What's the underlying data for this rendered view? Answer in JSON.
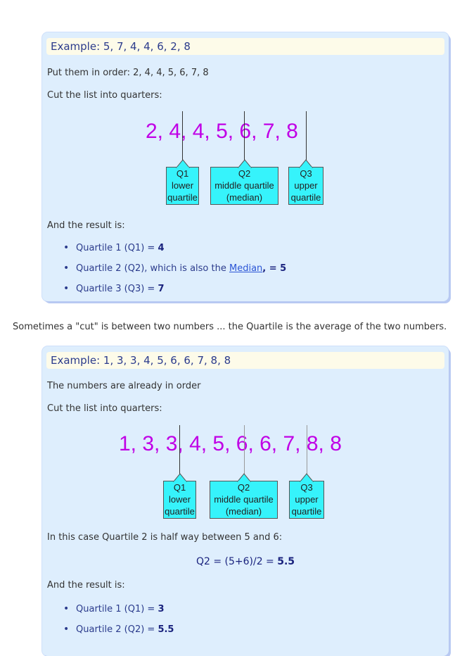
{
  "example1": {
    "title": "Example: 5, 7, 4, 4, 6, 2, 8",
    "order_text": "Put them in order: 2, 4, 4, 5, 6, 7, 8",
    "cut_text": "Cut the list into quarters:",
    "numbers": "2,  4,  4,  5,  6,  7,  8",
    "q1": {
      "l1": "Q1",
      "l2": "lower",
      "l3": "quartile"
    },
    "q2": {
      "l1": "Q2",
      "l2": "middle quartile",
      "l3": "(median)"
    },
    "q3": {
      "l1": "Q3",
      "l2": "upper",
      "l3": "quartile"
    },
    "result_text": "And the result is:",
    "bullets": [
      {
        "label": "Quartile 1 (Q1) = ",
        "value": "4"
      },
      {
        "label": "Quartile 2 (Q2), which is also the ",
        "link": "Median",
        "tail": ", = ",
        "value": "5"
      },
      {
        "label": "Quartile 3 (Q3) = ",
        "value": "7"
      }
    ]
  },
  "between_text": "Sometimes a \"cut\" is between two numbers ... the Quartile is the average of the two numbers.",
  "example2": {
    "title": "Example: 1, 3, 3, 4, 5, 6, 6, 7, 8, 8",
    "order_text": "The numbers are already in order",
    "cut_text": "Cut the list into quarters:",
    "numbers": "1, 3, 3, 4, 5, 6, 6, 7, 8,  8",
    "q1": {
      "l1": "Q1",
      "l2": "lower",
      "l3": "quartile"
    },
    "q2": {
      "l1": "Q2",
      "l2": "middle quartile",
      "l3": "(median)"
    },
    "q3": {
      "l1": "Q3",
      "l2": "upper",
      "l3": "quartile"
    },
    "case_text": "In this case Quartile 2 is half way between 5 and 6:",
    "formula": "Q2 = (5+6)/2 = ",
    "formula_value": "5.5",
    "result_text": "And the result is:",
    "bullets": [
      {
        "label": "Quartile 1 (Q1) = ",
        "value": "3"
      },
      {
        "label": "Quartile 2 (Q2) = ",
        "value": "5.5"
      }
    ]
  }
}
